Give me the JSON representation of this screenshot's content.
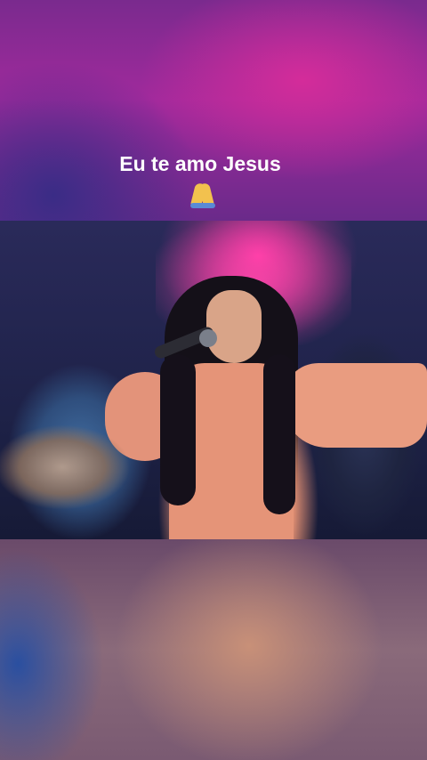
{
  "overlay": {
    "caption_text": "Eu te amo Jesus",
    "caption_emoji": "folded-hands-icon"
  },
  "colors": {
    "caption_text": "#ffffff",
    "background_top": "#a02a9c",
    "background_bottom": "#8a6a7a",
    "stage_light": "#ff3aa8",
    "singer_dress": "#e59478"
  }
}
